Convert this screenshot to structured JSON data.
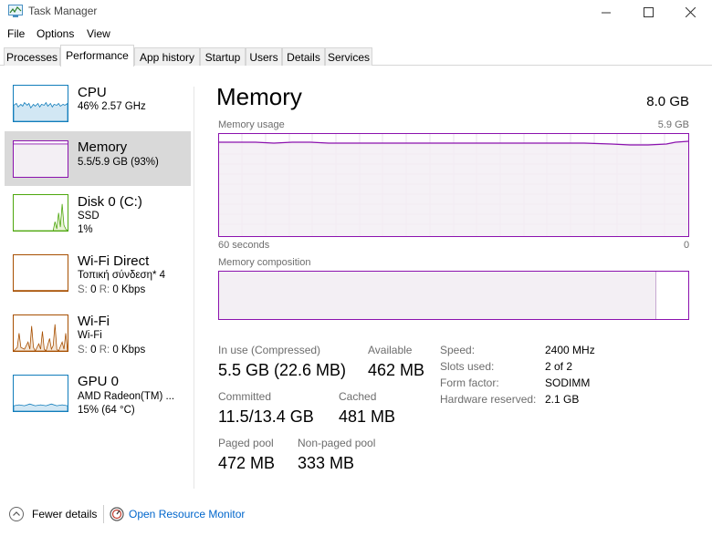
{
  "window": {
    "title": "Task Manager"
  },
  "menu": [
    "File",
    "Options",
    "View"
  ],
  "tabs": [
    {
      "label": "Processes"
    },
    {
      "label": "Performance"
    },
    {
      "label": "App history"
    },
    {
      "label": "Startup"
    },
    {
      "label": "Users"
    },
    {
      "label": "Details"
    },
    {
      "label": "Services"
    }
  ],
  "resources": [
    {
      "title": "CPU",
      "line1": "46% 2.57 GHz",
      "line2": "",
      "utilization": 0.46
    },
    {
      "title": "Memory",
      "line1": "5.5/5.9 GB (93%)",
      "line2": "",
      "utilization": 0.93
    },
    {
      "title": "Disk 0 (C:)",
      "line1": "SSD",
      "line2": "1%",
      "utilization": 0.01
    },
    {
      "title": "Wi-Fi Direct",
      "line1": "Τοπική σύνδεση* 4",
      "line2": {
        "s_label": "S:",
        "s_value": "0",
        "r_label": "R:",
        "r_value": "0 Kbps"
      }
    },
    {
      "title": "Wi-Fi",
      "line1": "Wi-Fi",
      "line2": {
        "s_label": "S:",
        "s_value": "0",
        "r_label": "R:",
        "r_value": "0 Kbps"
      }
    },
    {
      "title": "GPU 0",
      "line1": "AMD Radeon(TM) ...",
      "line2": "15% (64 °C)",
      "utilization": 0.15
    }
  ],
  "memory": {
    "heading": "Memory",
    "total": "8.0 GB",
    "usage_label": "Memory usage",
    "usage_max": "5.9 GB",
    "time_left": "60 seconds",
    "time_right": "0",
    "composition_label": "Memory composition",
    "in_use_fraction": 0.93,
    "stats": {
      "in_use_label": "In use (Compressed)",
      "in_use_value": "5.5 GB (22.6 MB)",
      "available_label": "Available",
      "available_value": "462 MB",
      "committed_label": "Committed",
      "committed_value": "11.5/13.4 GB",
      "cached_label": "Cached",
      "cached_value": "481 MB",
      "paged_label": "Paged pool",
      "paged_value": "472 MB",
      "nonpaged_label": "Non-paged pool",
      "nonpaged_value": "333 MB"
    },
    "specs": [
      {
        "label": "Speed:",
        "value": "2400 MHz"
      },
      {
        "label": "Slots used:",
        "value": "2 of 2"
      },
      {
        "label": "Form factor:",
        "value": "SODIMM"
      },
      {
        "label": "Hardware reserved:",
        "value": "2.1 GB"
      }
    ]
  },
  "footer": {
    "fewer_details": "Fewer details",
    "open_resource_monitor": "Open Resource Monitor"
  },
  "colors": {
    "cpu": "#117dbb",
    "memory": "#8b12ae",
    "disk": "#4da60c",
    "network": "#a74f01",
    "gpu": "#117dbb"
  }
}
